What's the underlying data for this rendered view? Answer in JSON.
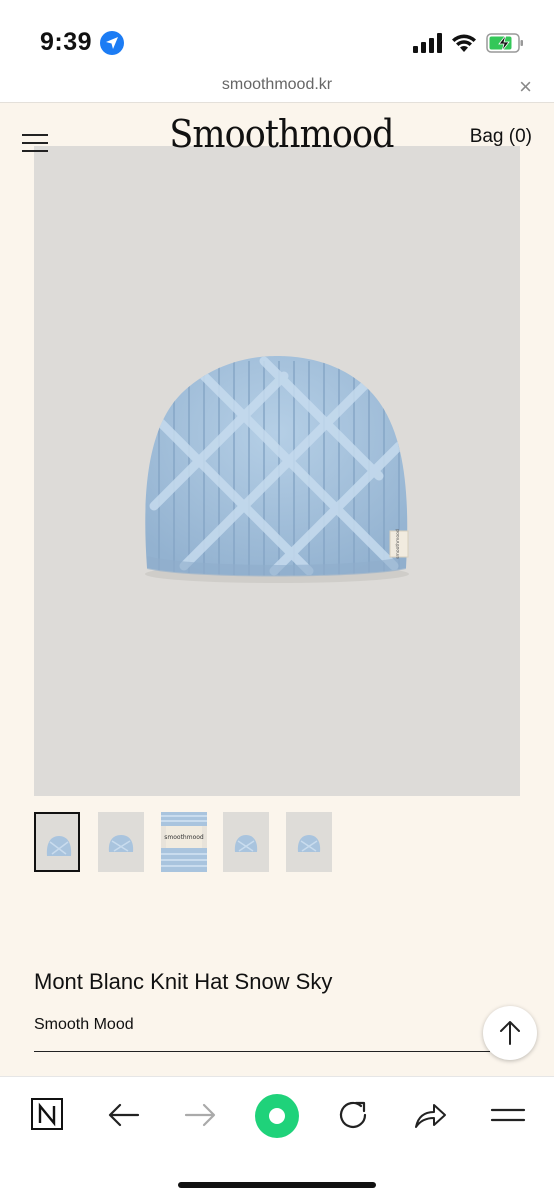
{
  "status": {
    "time": "9:39"
  },
  "browser": {
    "url": "smoothmood.kr",
    "close": "×"
  },
  "header": {
    "logo": "Smoothmood",
    "bag": "Bag (0)"
  },
  "gallery": {
    "thumbnail_count": 5,
    "selected_index": 0,
    "label_text": "smoothmood"
  },
  "product": {
    "title": "Mont Blanc Knit Hat Snow Sky",
    "brand": "Smooth Mood"
  },
  "colors": {
    "background": "#fbf5ec",
    "hat": "#a9c4de",
    "accent_green": "#1fd27a"
  }
}
